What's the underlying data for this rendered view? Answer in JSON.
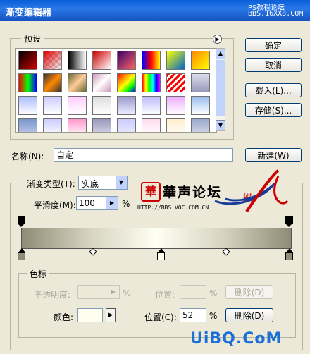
{
  "window": {
    "title": "渐变编辑器",
    "watermark_1": "PS教程论坛",
    "watermark_2": "BBS.16XX8.COM"
  },
  "presets": {
    "label": "预设",
    "menu_icon": "arrow-right-circle-icon",
    "swatches": [
      "linear-gradient(135deg,#000,#c00)",
      "checker-red",
      "linear-gradient(90deg,#000,#fff)",
      "linear-gradient(135deg,#c00,#fff)",
      "linear-gradient(135deg,#3a006a,#f66)",
      "linear-gradient(90deg,#00f,#f00,#ff0)",
      "linear-gradient(135deg,#ff0,#06c)",
      "linear-gradient(135deg,#f80,#ff0)",
      "linear-gradient(90deg,#f00,#0f0,#00f)",
      "linear-gradient(135deg,#333,#f80,#333)",
      "linear-gradient(135deg,#663,#fc9,#663)",
      "linear-gradient(135deg,#c9b,#fff,#c9b)",
      "linear-gradient(135deg,#f00,#f80,#ff0,#0f0,#00f)",
      "linear-gradient(90deg,#f00,#ff0,#0f0,#0ff,#00f,#f0f)",
      "repeating-linear-gradient(135deg,#f00 0 3px,#fff 3px 6px)",
      "linear-gradient(#dde,#99b)",
      "linear-gradient(#abf,#fff)",
      "linear-gradient(#ccf,#fff)",
      "linear-gradient(#fcf,#fff)",
      "linear-gradient(#ddd,#fff)",
      "linear-gradient(#99c,#eef)",
      "linear-gradient(#bbf,#fff)",
      "linear-gradient(#eaf,#fff)",
      "linear-gradient(#9be,#fff)",
      "linear-gradient(#79c,#cce)",
      "linear-gradient(#ccf,#fff)",
      "linear-gradient(#f9c,#fff)",
      "linear-gradient(#99b,#dde)",
      "linear-gradient(#ccf,#eef)",
      "linear-gradient(#fde,#fff)",
      "linear-gradient(#fec,#fff)",
      "linear-gradient(#9ac,#dde)"
    ]
  },
  "buttons": {
    "ok": "确定",
    "cancel": "取消",
    "load": "载入(L)...",
    "save": "存储(S)...",
    "new": "新建(W)",
    "delete_disabled": "删除(D)",
    "delete": "删除(D)"
  },
  "name": {
    "label": "名称(N):",
    "value": "自定"
  },
  "gradient_settings": {
    "type_label": "渐变类型(T):",
    "type_value": "实底",
    "smoothness_label": "平滑度(M):",
    "smoothness_value": "100",
    "smoothness_unit": "%"
  },
  "logo": {
    "text": "華声论坛",
    "url": "HTTP://BBS.VOC.COM.CN",
    "tag": "蝶"
  },
  "color_stops": {
    "group_label": "色标",
    "opacity_label": "不透明度:",
    "opacity_unit": "%",
    "location_label_disabled": "位置:",
    "location_unit_disabled": "%",
    "color_label": "颜色:",
    "location_label": "位置(C):",
    "location_value": "52",
    "location_unit": "%"
  },
  "colors": {
    "gradient": [
      "#8e8c76",
      "#d6d4c0",
      "#fffff2",
      "#d6d4c0",
      "#8e8c76"
    ],
    "stop_color": "#fffff0"
  },
  "footer_watermark": "UiBQ.CoM"
}
